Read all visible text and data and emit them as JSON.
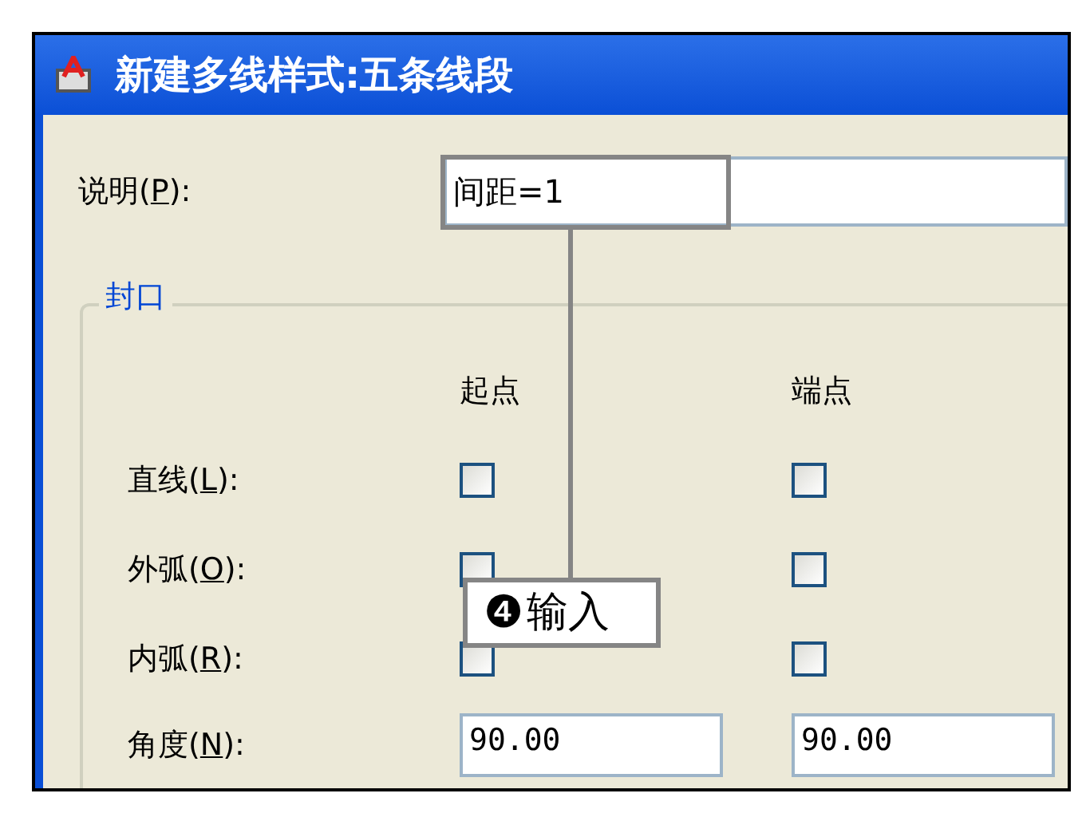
{
  "window": {
    "title": "新建多线样式:五条线段"
  },
  "description": {
    "prefix": "说明(",
    "key": "P",
    "suffix": "):",
    "value": "间距=1"
  },
  "caps": {
    "legend": "封口",
    "columns": [
      "起点",
      "端点"
    ],
    "rows": [
      {
        "kind": "checkbox",
        "prefix": "直线(",
        "key": "L",
        "suffix": "):",
        "start": {
          "checked": false
        },
        "end": {
          "checked": false
        }
      },
      {
        "kind": "checkbox",
        "prefix": "外弧(",
        "key": "O",
        "suffix": "):",
        "start": {
          "checked": false
        },
        "end": {
          "checked": false
        }
      },
      {
        "kind": "checkbox",
        "prefix": "内弧(",
        "key": "R",
        "suffix": "):",
        "start": {
          "checked": false
        },
        "end": {
          "checked": false
        }
      },
      {
        "kind": "field",
        "prefix": "角度(",
        "key": "N",
        "suffix": "):",
        "start": {
          "value": "90.00"
        },
        "end": {
          "value": "90.00"
        }
      }
    ]
  },
  "callout": {
    "number": "❹",
    "text": "输入"
  }
}
